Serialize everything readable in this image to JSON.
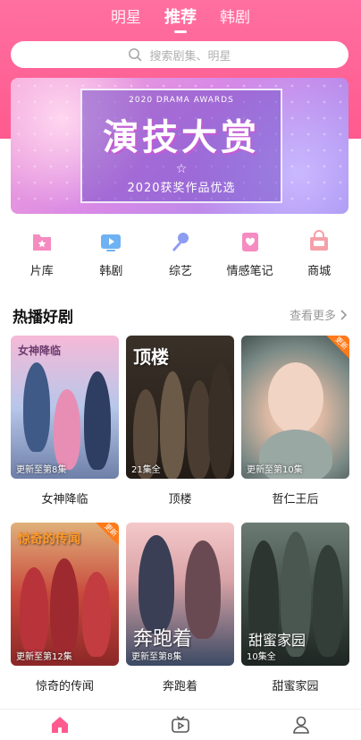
{
  "tabs": [
    {
      "label": "明星",
      "active": false
    },
    {
      "label": "推荐",
      "active": true
    },
    {
      "label": "韩剧",
      "active": false
    }
  ],
  "search": {
    "placeholder": "搜索剧集、明星"
  },
  "banner": {
    "subtitle": "2020 DRAMA AWARDS",
    "title": "演技大赏",
    "caption": "2020获奖作品优选"
  },
  "categories": [
    {
      "label": "片库",
      "icon": "film-library-icon"
    },
    {
      "label": "韩剧",
      "icon": "play-screen-icon"
    },
    {
      "label": "综艺",
      "icon": "microphone-icon"
    },
    {
      "label": "情感笔记",
      "icon": "heart-note-icon"
    },
    {
      "label": "商城",
      "icon": "shop-icon"
    }
  ],
  "section": {
    "title": "热播好剧",
    "more": "查看更多"
  },
  "dramas": [
    {
      "title": "女神降临",
      "status": "更新至第8集",
      "poster_text": "女神降临",
      "badge": ""
    },
    {
      "title": "顶楼",
      "status": "21集全",
      "poster_text": "顶楼",
      "badge": ""
    },
    {
      "title": "哲仁王后",
      "status": "更新至第10集",
      "poster_text": "",
      "badge": "更新"
    },
    {
      "title": "惊奇的传闻",
      "status": "更新至第12集",
      "poster_text": "惊奇的传闻",
      "badge": "更新"
    },
    {
      "title": "奔跑着",
      "status": "更新至第8集",
      "poster_text": "奔跑着",
      "badge": ""
    },
    {
      "title": "甜蜜家园",
      "status": "10集全",
      "poster_text": "甜蜜家园",
      "badge": ""
    }
  ],
  "bottom_nav": [
    {
      "icon": "home-icon",
      "active": true
    },
    {
      "icon": "tv-icon",
      "active": false
    },
    {
      "icon": "profile-icon",
      "active": false
    }
  ],
  "colors": {
    "accent": "#ff5a8f",
    "header": "#ff6fa0"
  }
}
